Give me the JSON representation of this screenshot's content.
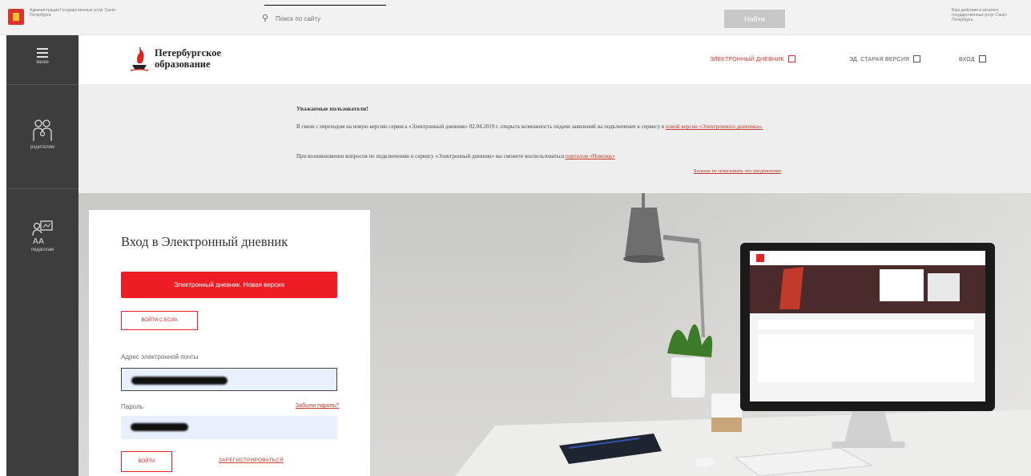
{
  "gov_bar": {
    "org_name": "Администрация Государственных услуг Санкт-Петербурга",
    "search_placeholder": "Поиск по сайту",
    "find_button": "Найти",
    "right_text": "Ваш действия в каталоге государственных услуг Санкт-Петербурга"
  },
  "sidebar": {
    "menu_label": "меню",
    "items": [
      {
        "label": "родителям",
        "icon": "parents-icon"
      },
      {
        "label": "педагогам",
        "icon": "teachers-icon"
      }
    ]
  },
  "header": {
    "site_title_line1": "Петербургское",
    "site_title_line2": "образование",
    "links": [
      {
        "label": "ЭЛЕКТРОННЫЙ ДНЕВНИК"
      },
      {
        "label": "ЭД. СТАРАЯ ВЕРСИЯ"
      },
      {
        "label": "ВХОД"
      }
    ]
  },
  "notice": {
    "title": "Уважаемые пользователи!",
    "p1_text": "В связи с переходом на новую версию сервиса «Электронный дневник» 02.04.2019 г. открыта возможность подачи заявлений на подключение к сервису в ",
    "p1_link": "новой версии «Электронного дневника».",
    "p2_text": "При возникновении вопросов по подключению к сервису «Электронный дневник» вы сможете воспользоваться ",
    "p2_link": "порталом «Помощь»",
    "more_link": "Больше не показывать это уведомление"
  },
  "login": {
    "title": "Вход в Электронный дневник",
    "new_version_button": "Электронный дневник. Новая версия",
    "esia_button": "ВОЙТИ С ЕСИА",
    "email_label": "Адрес электронной почты",
    "password_label": "Пароль",
    "forgot_link": "Забыли пароль?",
    "enter_button": "ВОЙТИ",
    "register_link": "ЗАРЕГИСТРИРОВАТЬСЯ"
  },
  "colors": {
    "accent_red": "#ee1c23",
    "sidebar_dark": "#3d3d3d"
  }
}
